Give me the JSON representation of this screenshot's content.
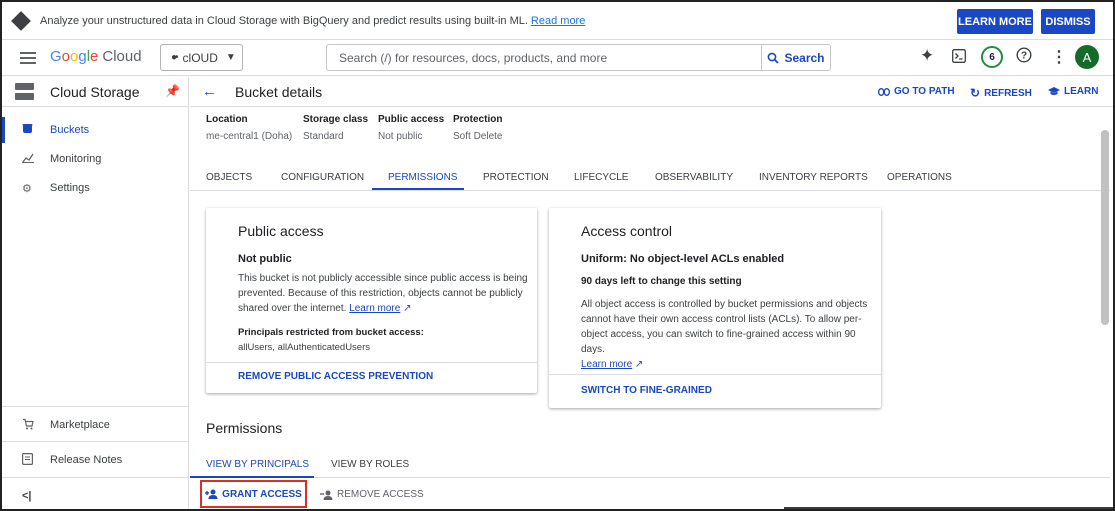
{
  "banner": {
    "message": "Analyze your unstructured data in Cloud Storage with BigQuery and predict results using built-in ML.",
    "link": "Read more",
    "learn_more": "LEARN MORE",
    "dismiss": "DISMISS"
  },
  "topbar": {
    "logo": [
      "G",
      "o",
      "o",
      "g",
      "l",
      "e"
    ],
    "logo_cloud": "Cloud",
    "project": "clOUD",
    "search_placeholder": "Search (/) for resources, docs, products, and more",
    "search_button": "Search",
    "notifications_count": "6",
    "avatar_letter": "A"
  },
  "sidebar": {
    "title": "Cloud Storage",
    "items": [
      {
        "label": "Buckets",
        "icon": "bucket-icon"
      },
      {
        "label": "Monitoring",
        "icon": "chart-icon"
      },
      {
        "label": "Settings",
        "icon": "gear-icon"
      }
    ],
    "bottom_items": [
      {
        "label": "Marketplace",
        "icon": "cart-icon"
      },
      {
        "label": "Release Notes",
        "icon": "notes-icon"
      }
    ],
    "collapse": "<|"
  },
  "main": {
    "title": "Bucket details",
    "actions": {
      "go_to_path": "GO TO PATH",
      "refresh": "REFRESH",
      "learn": "LEARN"
    },
    "meta": [
      {
        "label": "Location",
        "value": "me-central1 (Doha)"
      },
      {
        "label": "Storage class",
        "value": "Standard"
      },
      {
        "label": "Public access",
        "value": "Not public"
      },
      {
        "label": "Protection",
        "value": "Soft Delete"
      }
    ],
    "tabs": [
      "OBJECTS",
      "CONFIGURATION",
      "PERMISSIONS",
      "PROTECTION",
      "LIFECYCLE",
      "OBSERVABILITY",
      "INVENTORY REPORTS",
      "OPERATIONS"
    ],
    "active_tab": "PERMISSIONS",
    "public_card": {
      "title": "Public access",
      "status": "Not public",
      "desc_line1": "This bucket is not publicly accessible since public access is being",
      "desc_line2": "prevented. Because of this restriction, objects cannot be publicly",
      "desc_line3": "shared over the internet.",
      "learn_more": "Learn more",
      "principals_label": "Principals restricted from bucket access:",
      "principals_value": "allUsers, allAuthenticatedUsers",
      "action": "REMOVE PUBLIC ACCESS PREVENTION"
    },
    "access_card": {
      "title": "Access control",
      "status": "Uniform: No object-level ACLs enabled",
      "days_left": "90 days left to change this setting",
      "desc_line1": "All object access is controlled by bucket permissions and objects",
      "desc_line2": "cannot have their own access control lists (ACLs). To allow per-",
      "desc_line3": "object access, you can switch to fine-grained access within 90 days.",
      "learn_more": "Learn more",
      "action": "SWITCH TO FINE-GRAINED"
    },
    "permissions": {
      "title": "Permissions",
      "tabs": [
        "VIEW BY PRINCIPALS",
        "VIEW BY ROLES"
      ],
      "grant": "GRANT ACCESS",
      "remove": "REMOVE ACCESS"
    }
  },
  "colors": {
    "accent": "#1a47c4",
    "highlight_border": "#d93025",
    "avatar": "#176b2a"
  }
}
